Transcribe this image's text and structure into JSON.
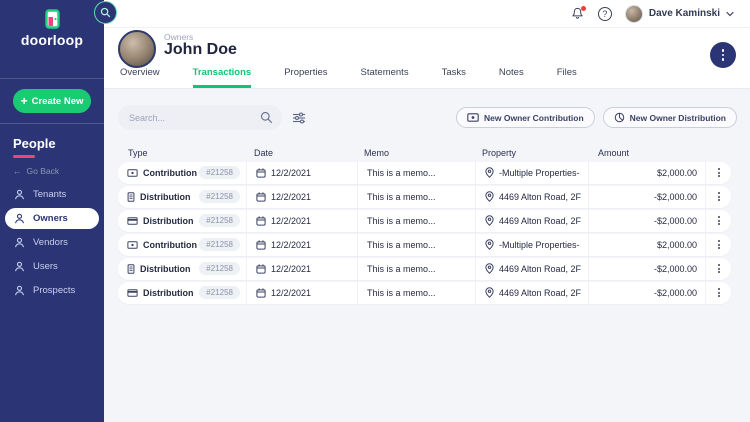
{
  "brand": {
    "logo_text": "doorloop"
  },
  "topbar": {
    "user_name": "Dave Kaminski"
  },
  "sidebar": {
    "create_new_label": "Create New",
    "section_title": "People",
    "back_label": "Go Back",
    "items": [
      {
        "label": "Tenants",
        "selected": false
      },
      {
        "label": "Owners",
        "selected": true
      },
      {
        "label": "Vendors",
        "selected": false
      },
      {
        "label": "Users",
        "selected": false
      },
      {
        "label": "Prospects",
        "selected": false
      }
    ]
  },
  "header": {
    "entity_type": "Owners",
    "name": "John Doe",
    "tabs": [
      {
        "label": "Overview",
        "active": false
      },
      {
        "label": "Transactions",
        "active": true
      },
      {
        "label": "Properties",
        "active": false
      },
      {
        "label": "Statements",
        "active": false
      },
      {
        "label": "Tasks",
        "active": false
      },
      {
        "label": "Notes",
        "active": false
      },
      {
        "label": "Files",
        "active": false
      }
    ]
  },
  "toolbar": {
    "search_placeholder": "Search...",
    "new_contribution_label": "New Owner Contribution",
    "new_distribution_label": "New Owner Distribution"
  },
  "table": {
    "columns": {
      "type": "Type",
      "date": "Date",
      "memo": "Memo",
      "property": "Property",
      "amount": "Amount"
    },
    "rows": [
      {
        "type": "Contribution",
        "icon": "banknote-icon",
        "ref": "#21258",
        "date": "12/2/2021",
        "memo": "This is a memo...",
        "property": "-Multiple Properties-",
        "amount": "$2,000.00"
      },
      {
        "type": "Distribution",
        "icon": "receipt-icon",
        "ref": "#21258",
        "date": "12/2/2021",
        "memo": "This is a memo...",
        "property": "4469 Alton Road, 2F",
        "amount": "-$2,000.00"
      },
      {
        "type": "Distribution",
        "icon": "card-icon",
        "ref": "#21258",
        "date": "12/2/2021",
        "memo": "This is a memo...",
        "property": "4469 Alton Road, 2F",
        "amount": "-$2,000.00"
      },
      {
        "type": "Contribution",
        "icon": "banknote-icon",
        "ref": "#21258",
        "date": "12/2/2021",
        "memo": "This is a memo...",
        "property": "-Multiple Properties-",
        "amount": "$2,000.00"
      },
      {
        "type": "Distribution",
        "icon": "receipt-icon",
        "ref": "#21258",
        "date": "12/2/2021",
        "memo": "This is a memo...",
        "property": "4469 Alton Road, 2F",
        "amount": "-$2,000.00"
      },
      {
        "type": "Distribution",
        "icon": "card-icon",
        "ref": "#21258",
        "date": "12/2/2021",
        "memo": "This is a memo...",
        "property": "4469 Alton Road, 2F",
        "amount": "-$2,000.00"
      }
    ]
  },
  "colors": {
    "sidebar_bg": "#2b3575",
    "accent_green": "#1acb73",
    "accent_pink": "#f0437e",
    "content_bg": "#f4f5f9",
    "text_dark": "#252b42",
    "badge_bg": "#edf0f5",
    "notification_red": "#f03e3e"
  }
}
